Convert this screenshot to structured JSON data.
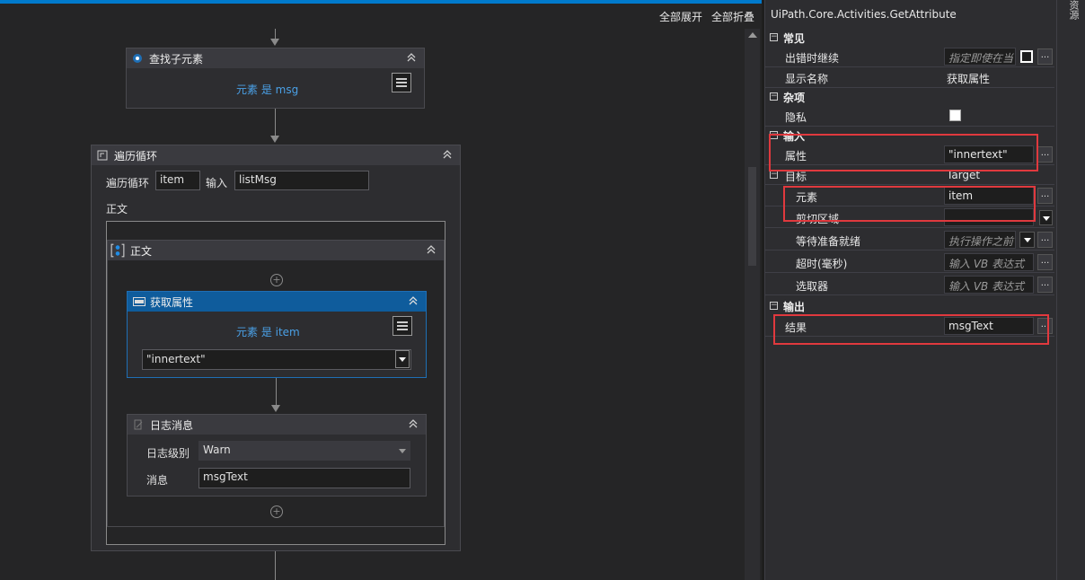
{
  "designer": {
    "toolbar": {
      "expand_all": "全部展开",
      "collapse_all": "全部折叠"
    },
    "find_children": {
      "title": "查找子元素",
      "summary": "元素 是 msg"
    },
    "foreach": {
      "title": "遍历循环",
      "loop_label": "遍历循环",
      "item_value": "item",
      "input_label": "输入",
      "input_value": "listMsg",
      "body_label": "正文",
      "sequence": {
        "title": "正文",
        "get_attribute": {
          "title": "获取属性",
          "summary": "元素 是 item",
          "attribute_value": "\"innertext\""
        },
        "log_message": {
          "title": "日志消息",
          "level_label": "日志级别",
          "level_value": "Warn",
          "message_label": "消息",
          "message_value": "msgText"
        }
      }
    }
  },
  "properties": {
    "title": "UiPath.Core.Activities.GetAttribute",
    "categories": {
      "common": "常见",
      "misc": "杂项",
      "input": "输入",
      "output": "输出"
    },
    "common": {
      "continue_on_error_label": "出错时继续",
      "continue_on_error_placeholder": "指定即使在当",
      "display_name_label": "显示名称",
      "display_name_value": "获取属性"
    },
    "misc": {
      "private_label": "隐私"
    },
    "input": {
      "attribute_label": "属性",
      "attribute_value": "\"innertext\"",
      "target_label": "目标",
      "target_value": "Target",
      "element_label": "元素",
      "element_value": "item",
      "clipping_label": "剪切区域",
      "clipping_value": "",
      "wait_ready_label": "等待准备就绪",
      "wait_ready_placeholder": "执行操作之前",
      "timeout_label": "超时(毫秒)",
      "timeout_placeholder": "输入 VB 表达式",
      "selector_label": "选取器",
      "selector_placeholder": "输入 VB 表达式"
    },
    "output": {
      "result_label": "结果",
      "result_value": "msgText"
    },
    "dots": "..."
  },
  "right_strip": {
    "tab": "资源"
  },
  "colors": {
    "accent": "#007acc",
    "selected_header": "#0f5c9c",
    "highlight": "#e0393e",
    "link": "#4aa0e6"
  }
}
